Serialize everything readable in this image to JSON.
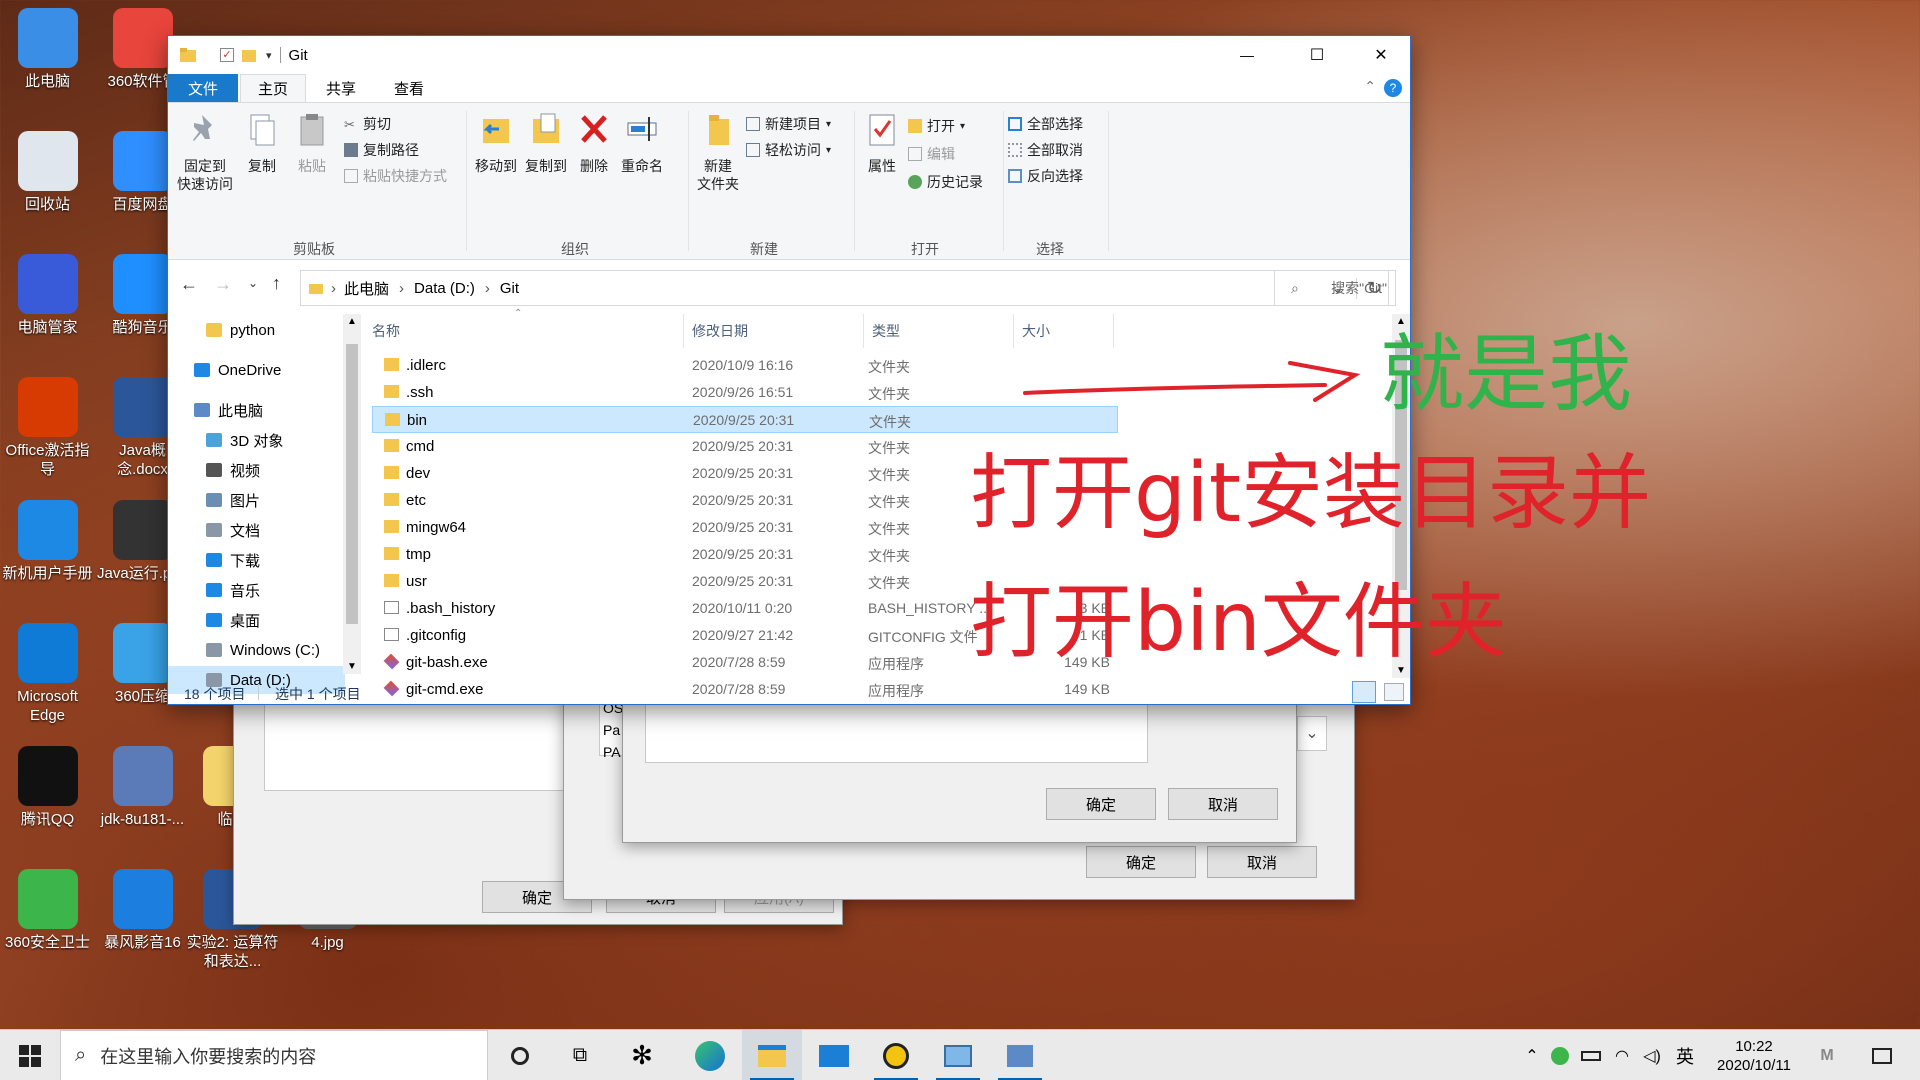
{
  "desktop": {
    "icons": [
      {
        "label": "此电脑",
        "icon": "computer-icon",
        "color": "#3a8ee6"
      },
      {
        "label": "360软件管",
        "icon": "app-360-software-icon",
        "color": "#e8453c"
      },
      {
        "label": "回收站",
        "icon": "recycle-bin-icon",
        "color": "#dfe6ee"
      },
      {
        "label": "百度网盘",
        "icon": "baidu-netdisk-icon",
        "color": "#2f8fff"
      },
      {
        "label": "电脑管家",
        "icon": "pc-manager-icon",
        "color": "#3a5bd9"
      },
      {
        "label": "酷狗音乐",
        "icon": "kugou-icon",
        "color": "#1f8fff"
      },
      {
        "label": "Office激活指导",
        "icon": "office-icon",
        "color": "#d83b01"
      },
      {
        "label": "Java概念.docx",
        "icon": "word-doc-icon",
        "color": "#2b579a"
      },
      {
        "label": "新机用户手册",
        "icon": "manual-icon",
        "color": "#1e88e5"
      },
      {
        "label": "Java运行.png",
        "icon": "image-file-icon",
        "color": "#333333"
      },
      {
        "label": "Microsoft Edge",
        "icon": "edge-icon",
        "color": "#0f7bd6"
      },
      {
        "label": "360压缩",
        "icon": "zip-icon",
        "color": "#3aa3e8"
      },
      {
        "label": "腾讯QQ",
        "icon": "qq-icon",
        "color": "#111111"
      },
      {
        "label": "jdk-8u181-...",
        "icon": "java-installer-icon",
        "color": "#5b7ab8"
      },
      {
        "label": "360安全卫士",
        "icon": "security-360-icon",
        "color": "#3cb54a"
      },
      {
        "label": "暴风影音16",
        "icon": "baofeng-icon",
        "color": "#1c7fe0"
      },
      {
        "label": "实验2: 运算符和表达...",
        "icon": "word-doc-icon",
        "color": "#2b579a"
      },
      {
        "label": "4.jpg",
        "icon": "image-file-icon",
        "color": "#666666"
      },
      {
        "label": "临时",
        "icon": "folder-icon",
        "color": "#f3d36b"
      }
    ]
  },
  "back_dialogs": {
    "rear": {
      "ok": "确定",
      "cancel": "取消",
      "apply": "应用(A)"
    },
    "middle": {
      "ok": "确定",
      "cancel": "取消",
      "snippets": [
        "OS",
        "Pa",
        "PA"
      ]
    },
    "front": {
      "ok": "确定",
      "cancel": "取消"
    }
  },
  "explorer": {
    "title": "Git",
    "window_controls": {
      "minimize": "—",
      "maximize": "☐",
      "close": "✕"
    },
    "ribbon_tabs": [
      "文件",
      "主页",
      "共享",
      "查看"
    ],
    "ribbon": {
      "clipboard": {
        "pin": "固定到\n快速访问",
        "copy": "复制",
        "paste": "粘贴",
        "cut": "剪切",
        "copy_path": "复制路径",
        "paste_shortcut": "粘贴快捷方式",
        "label": "剪贴板"
      },
      "organize": {
        "move_to": "移动到",
        "copy_to": "复制到",
        "delete": "删除",
        "rename": "重命名",
        "label": "组织"
      },
      "new": {
        "new_folder": "新建\n文件夹",
        "new_item": "新建项目",
        "easy_access": "轻松访问",
        "label": "新建"
      },
      "open": {
        "properties": "属性",
        "open": "打开",
        "edit": "编辑",
        "history": "历史记录",
        "label": "打开"
      },
      "select": {
        "select_all": "全部选择",
        "select_none": "全部取消",
        "invert": "反向选择",
        "label": "选择"
      }
    },
    "address": {
      "crumbs": [
        "此电脑",
        "Data (D:)",
        "Git"
      ],
      "search_placeholder": "搜索\"Git\""
    },
    "nav": [
      {
        "label": "python",
        "icon": "folder-icon"
      },
      {
        "label": "OneDrive",
        "icon": "onedrive-icon"
      },
      {
        "label": "此电脑",
        "icon": "computer-icon"
      },
      {
        "label": "3D 对象",
        "icon": "3d-objects-icon"
      },
      {
        "label": "视频",
        "icon": "video-icon"
      },
      {
        "label": "图片",
        "icon": "pictures-icon"
      },
      {
        "label": "文档",
        "icon": "documents-icon"
      },
      {
        "label": "下载",
        "icon": "downloads-icon"
      },
      {
        "label": "音乐",
        "icon": "music-icon"
      },
      {
        "label": "桌面",
        "icon": "desktop-icon"
      },
      {
        "label": "Windows (C:)",
        "icon": "drive-c-icon"
      },
      {
        "label": "Data (D:)",
        "icon": "drive-d-icon"
      }
    ],
    "columns": [
      "名称",
      "修改日期",
      "类型",
      "大小"
    ],
    "files": [
      {
        "name": ".idlerc",
        "date": "2020/10/9 16:16",
        "type": "文件夹",
        "size": "",
        "kind": "folder"
      },
      {
        "name": ".ssh",
        "date": "2020/9/26 16:51",
        "type": "文件夹",
        "size": "",
        "kind": "folder"
      },
      {
        "name": "bin",
        "date": "2020/9/25 20:31",
        "type": "文件夹",
        "size": "",
        "kind": "folder"
      },
      {
        "name": "cmd",
        "date": "2020/9/25 20:31",
        "type": "文件夹",
        "size": "",
        "kind": "folder"
      },
      {
        "name": "dev",
        "date": "2020/9/25 20:31",
        "type": "文件夹",
        "size": "",
        "kind": "folder"
      },
      {
        "name": "etc",
        "date": "2020/9/25 20:31",
        "type": "文件夹",
        "size": "",
        "kind": "folder"
      },
      {
        "name": "mingw64",
        "date": "2020/9/25 20:31",
        "type": "文件夹",
        "size": "",
        "kind": "folder"
      },
      {
        "name": "tmp",
        "date": "2020/9/25 20:31",
        "type": "文件夹",
        "size": "",
        "kind": "folder"
      },
      {
        "name": "usr",
        "date": "2020/9/25 20:31",
        "type": "文件夹",
        "size": "",
        "kind": "folder"
      },
      {
        "name": ".bash_history",
        "date": "2020/10/11 0:20",
        "type": "BASH_HISTORY ...",
        "size": "3 KB",
        "kind": "file"
      },
      {
        "name": ".gitconfig",
        "date": "2020/9/27 21:42",
        "type": "GITCONFIG 文件",
        "size": "1 KB",
        "kind": "file"
      },
      {
        "name": "git-bash.exe",
        "date": "2020/7/28 8:59",
        "type": "应用程序",
        "size": "149 KB",
        "kind": "exe"
      },
      {
        "name": "git-cmd.exe",
        "date": "2020/7/28 8:59",
        "type": "应用程序",
        "size": "149 KB",
        "kind": "exe"
      }
    ],
    "selected_row": 2,
    "status": {
      "count": "18 个项目",
      "selected": "选中 1 个项目"
    }
  },
  "annotations": {
    "here": "就是我",
    "step1": "打开git安装目录并",
    "step2": "打开bin文件夹",
    "green": "#2fb34a",
    "red": "#e0222a"
  },
  "taskbar": {
    "search_placeholder": "在这里输入你要搜索的内容",
    "apps": [
      "task-view-icon",
      "pinwheel-app-icon",
      "edge-icon",
      "file-explorer-icon",
      "mail-icon",
      "app-icon",
      "control-panel-icon",
      "settings-app-icon"
    ],
    "ime": "英",
    "time": "10:22",
    "date": "2020/10/11"
  }
}
